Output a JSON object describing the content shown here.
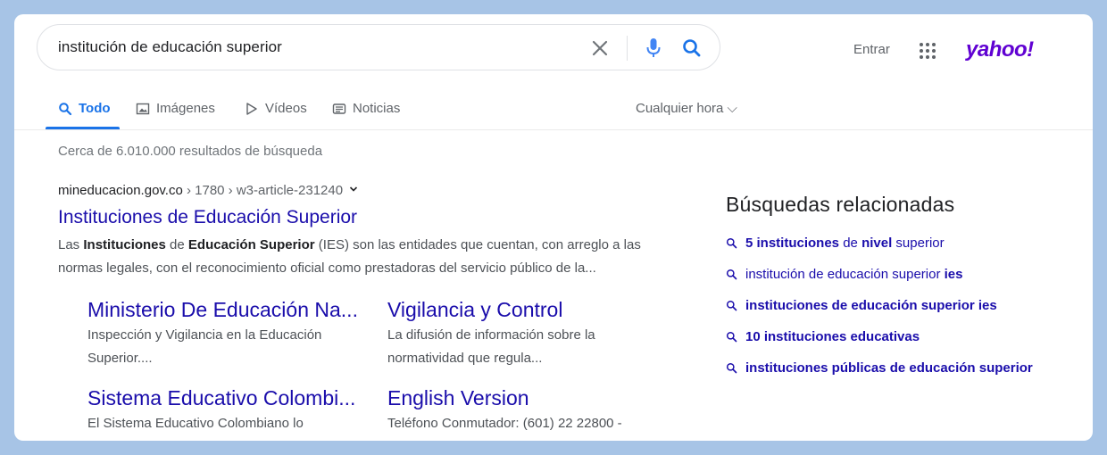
{
  "search": {
    "query": "institución de educación superior"
  },
  "header": {
    "signin_label": "Entrar",
    "logo_text": "yahoo!",
    "logo_color": "#6001d2"
  },
  "tabs": [
    {
      "label": "Todo",
      "icon": "search-icon",
      "active": true
    },
    {
      "label": "Imágenes",
      "icon": "image-icon"
    },
    {
      "label": "Vídeos",
      "icon": "play-icon"
    },
    {
      "label": "Noticias",
      "icon": "news-icon"
    }
  ],
  "filter": {
    "time_label": "Cualquier hora ⌵"
  },
  "stats": "Cerca de 6.010.000 resultados de búsqueda",
  "result": {
    "domain": "mineducacion.gov.co",
    "path": " › 1780 › w3-article-231240",
    "title": "Instituciones de Educación Superior",
    "snippet": {
      "p1": "Las ",
      "b1": "Instituciones",
      "p2": " de ",
      "b2": "Educación Superior",
      "p3": " (IES) son las entidades que cuentan, con arreglo a las normas legales, con el reconocimiento oficial como prestadoras del servicio público de la..."
    },
    "sitelinks": [
      {
        "title": "Ministerio De Educación Na...",
        "desc": "Inspección y Vigilancia en la Educación Superior...."
      },
      {
        "title": "Vigilancia y Control",
        "desc": "La difusión de información sobre la normatividad que regula..."
      },
      {
        "title": "Sistema Educativo Colombi...",
        "desc": "El Sistema Educativo Colombiano lo"
      },
      {
        "title": "English Version",
        "desc": "Teléfono Conmutador: (601) 22 22800 -"
      }
    ]
  },
  "related": {
    "heading": "Búsquedas relacionadas",
    "items": [
      {
        "parts": [
          {
            "t": "5 instituciones",
            "b": true
          },
          {
            "t": " de ",
            "b": false
          },
          {
            "t": "nivel",
            "b": true
          },
          {
            "t": " superior",
            "b": false
          }
        ]
      },
      {
        "parts": [
          {
            "t": "institución de educación superior ",
            "b": false
          },
          {
            "t": "ies",
            "b": true
          }
        ]
      },
      {
        "parts": [
          {
            "t": "instituciones de educación superior ies",
            "b": true
          }
        ]
      },
      {
        "parts": [
          {
            "t": "10 instituciones educativas",
            "b": true
          }
        ]
      },
      {
        "parts": [
          {
            "t": "instituciones públicas de educación superior",
            "b": true
          }
        ]
      }
    ]
  },
  "colors": {
    "link": "#1a0dab",
    "accent": "#1a73e8",
    "background": "#a7c4e6"
  }
}
